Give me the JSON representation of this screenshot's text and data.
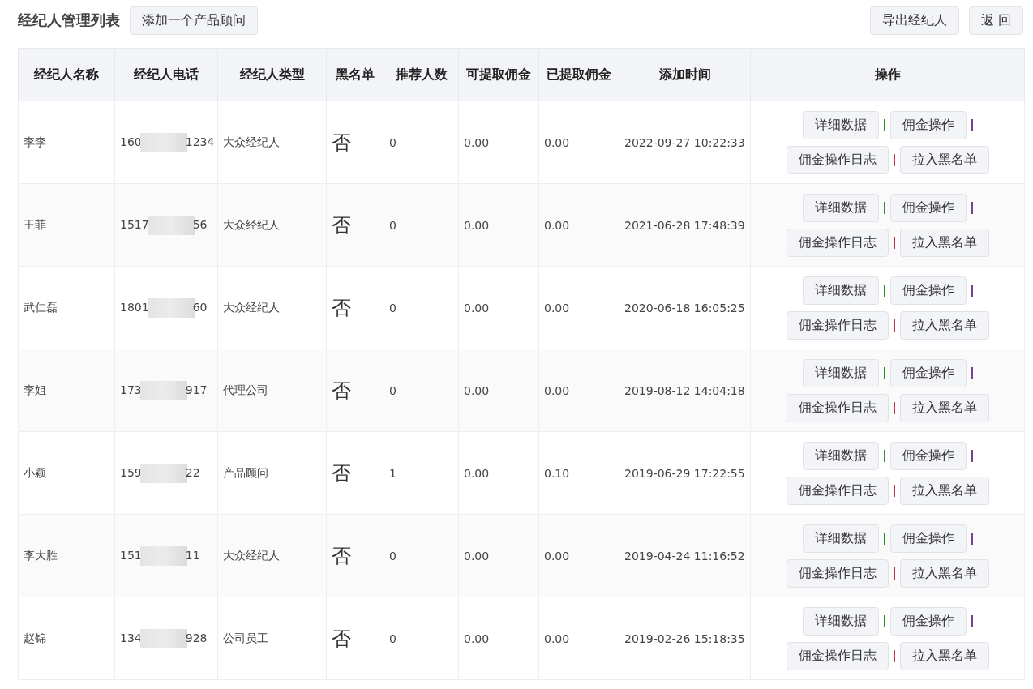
{
  "header": {
    "title": "经纪人管理列表",
    "add_button": "添加一个产品顾问",
    "export_button": "导出经纪人",
    "back_button": "返 回"
  },
  "table": {
    "columns": [
      "经纪人名称",
      "经纪人电话",
      "经纪人类型",
      "黑名单",
      "推荐人数",
      "可提取佣金",
      "已提取佣金",
      "添加时间",
      "操作"
    ],
    "rows": [
      {
        "name": "李李",
        "phone_start": "160",
        "phone_end": "1234",
        "type": "大众经纪人",
        "blacklist": "否",
        "referrals": "0",
        "withdrawable": "0.00",
        "withdrawn": "0.00",
        "added": "2022-09-27 10:22:33",
        "actions": [
          {
            "label": "详细数据",
            "color": "#2e8b2e"
          },
          {
            "label": "佣金操作",
            "color": "#7a3d9a"
          },
          {
            "label": "佣金操作日志",
            "color": "#c0304a"
          },
          {
            "label": "拉入黑名单"
          }
        ]
      },
      {
        "name": "王菲",
        "phone_start": "1517",
        "phone_end": "56",
        "type": "大众经纪人",
        "blacklist": "否",
        "referrals": "0",
        "withdrawable": "0.00",
        "withdrawn": "0.00",
        "added": "2021-06-28 17:48:39",
        "actions": [
          {
            "label": "详细数据",
            "color": "#2e8b2e"
          },
          {
            "label": "佣金操作",
            "color": "#7a3d9a"
          },
          {
            "label": "佣金操作日志",
            "color": "#c0304a"
          },
          {
            "label": "拉入黑名单"
          }
        ]
      },
      {
        "name": "武仁磊",
        "phone_start": "1801",
        "phone_end": "60",
        "type": "大众经纪人",
        "blacklist": "否",
        "referrals": "0",
        "withdrawable": "0.00",
        "withdrawn": "0.00",
        "added": "2020-06-18 16:05:25",
        "actions": [
          {
            "label": "详细数据",
            "color": "#2e8b2e"
          },
          {
            "label": "佣金操作",
            "color": "#7a3d9a"
          },
          {
            "label": "佣金操作日志",
            "color": "#c0304a"
          },
          {
            "label": "拉入黑名单"
          }
        ]
      },
      {
        "name": "李姐",
        "phone_start": "173",
        "phone_end": "917",
        "type": "代理公司",
        "blacklist": "否",
        "referrals": "0",
        "withdrawable": "0.00",
        "withdrawn": "0.00",
        "added": "2019-08-12 14:04:18",
        "actions": [
          {
            "label": "详细数据",
            "color": "#2e8b2e"
          },
          {
            "label": "佣金操作",
            "color": "#7a3d9a"
          },
          {
            "label": "佣金操作日志",
            "color": "#c0304a"
          },
          {
            "label": "拉入黑名单"
          }
        ]
      },
      {
        "name": "小颖",
        "phone_start": "159",
        "phone_end": "22",
        "type": "产品顾问",
        "blacklist": "否",
        "referrals": "1",
        "withdrawable": "0.00",
        "withdrawn": "0.10",
        "added": "2019-06-29 17:22:55",
        "actions": [
          {
            "label": "详细数据",
            "color": "#2e8b2e"
          },
          {
            "label": "佣金操作",
            "color": "#7a3d9a"
          },
          {
            "label": "佣金操作日志",
            "color": "#c0304a"
          },
          {
            "label": "拉入黑名单"
          }
        ]
      },
      {
        "name": "李大胜",
        "phone_start": "151",
        "phone_end": "11",
        "type": "大众经纪人",
        "blacklist": "否",
        "referrals": "0",
        "withdrawable": "0.00",
        "withdrawn": "0.00",
        "added": "2019-04-24 11:16:52",
        "actions": [
          {
            "label": "详细数据",
            "color": "#2e8b2e"
          },
          {
            "label": "佣金操作",
            "color": "#7a3d9a"
          },
          {
            "label": "佣金操作日志",
            "color": "#c0304a"
          },
          {
            "label": "拉入黑名单"
          }
        ]
      },
      {
        "name": "赵锦",
        "phone_start": "134",
        "phone_end": "928",
        "type": "公司员工",
        "blacklist": "否",
        "referrals": "0",
        "withdrawable": "0.00",
        "withdrawn": "0.00",
        "added": "2019-02-26 15:18:35",
        "actions": [
          {
            "label": "详细数据",
            "color": "#2e8b2e"
          },
          {
            "label": "佣金操作",
            "color": "#7a3d9a"
          },
          {
            "label": "佣金操作日志",
            "color": "#c0304a"
          },
          {
            "label": "拉入黑名单"
          }
        ]
      }
    ]
  }
}
